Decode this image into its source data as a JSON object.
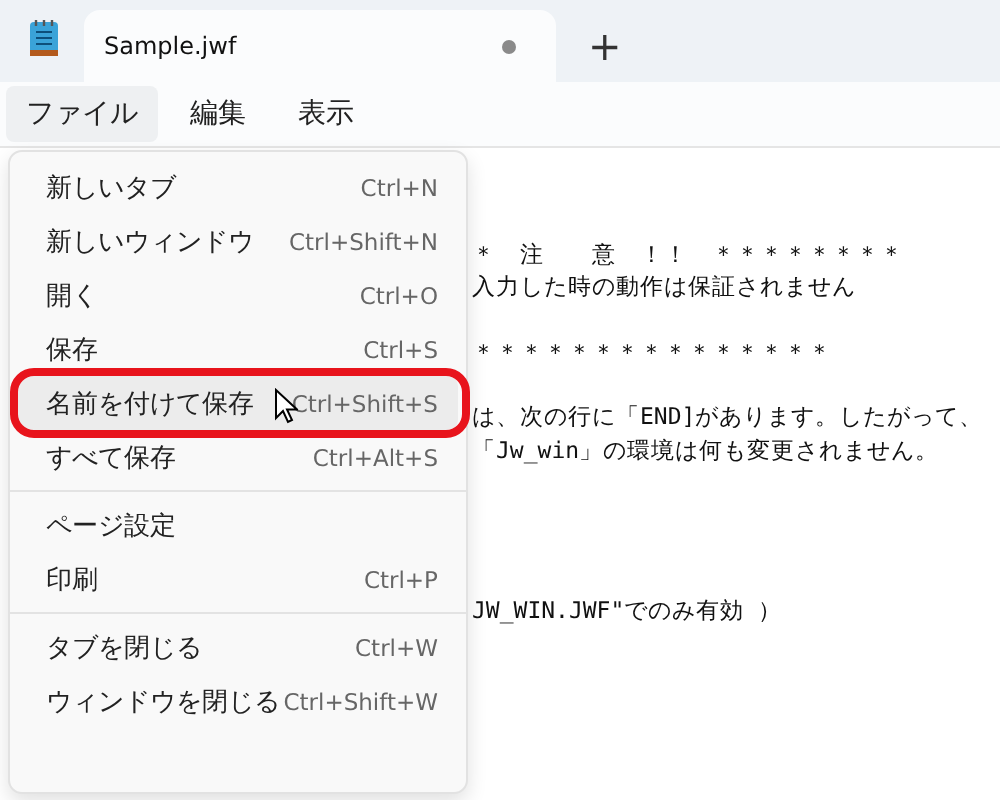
{
  "tab": {
    "title": "Sample.jwf",
    "modified": true,
    "new_tab": "+"
  },
  "menu_bar": [
    {
      "label": "ファイル",
      "selected": true
    },
    {
      "label": "編集",
      "selected": false
    },
    {
      "label": "表示",
      "selected": false
    }
  ],
  "editor_paragraphs": [
    [
      "＊　注　　意　！！　＊＊＊＊＊＊＊＊",
      "入力した時の動作は保証されません"
    ],
    [
      "＊＊＊＊＊＊＊＊＊＊＊＊＊＊＊"
    ],
    [
      "は、次の行に「END]があります。したがって、",
      "「Jw_win」の環境は何も変更されません。"
    ],
    [
      "JW_WIN.JWF\"でのみ有効 ）"
    ]
  ],
  "file_menu": [
    {
      "kind": "item",
      "label": "新しいタブ",
      "shortcut": "Ctrl+N",
      "selected": false
    },
    {
      "kind": "item",
      "label": "新しいウィンドウ",
      "shortcut": "Ctrl+Shift+N",
      "selected": false
    },
    {
      "kind": "item",
      "label": "開く",
      "shortcut": "Ctrl+O",
      "selected": false
    },
    {
      "kind": "item",
      "label": "保存",
      "shortcut": "Ctrl+S",
      "selected": false
    },
    {
      "kind": "item",
      "label": "名前を付けて保存",
      "shortcut": "Ctrl+Shift+S",
      "selected": true
    },
    {
      "kind": "item",
      "label": "すべて保存",
      "shortcut": "Ctrl+Alt+S",
      "selected": false
    },
    {
      "kind": "separator"
    },
    {
      "kind": "item",
      "label": "ページ設定",
      "selected": false
    },
    {
      "kind": "item",
      "label": "印刷",
      "shortcut": "Ctrl+P",
      "selected": false
    },
    {
      "kind": "separator"
    },
    {
      "kind": "item",
      "label": "タブを閉じる",
      "shortcut": "Ctrl+W",
      "selected": false
    },
    {
      "kind": "item",
      "label": "ウィンドウを閉じる",
      "shortcut": "Ctrl+Shift+W",
      "selected": false
    }
  ]
}
